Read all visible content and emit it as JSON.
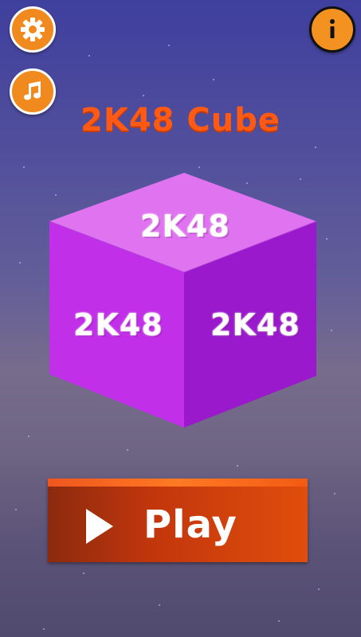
{
  "title": "2K48 Cube",
  "cube": {
    "top_label": "2K48",
    "left_label": "2K48",
    "right_label": "2K48"
  },
  "play_button": {
    "label": "Play"
  },
  "icons": {
    "settings": "gear-icon",
    "music": "music-note-icon",
    "info": "info-icon"
  },
  "colors": {
    "accent": "#f08a1e",
    "title": "#ff5a14",
    "cube_top": "#e074f0",
    "cube_left": "#c12fe8",
    "cube_right": "#9a19cc",
    "play_button": "#c2360c"
  }
}
